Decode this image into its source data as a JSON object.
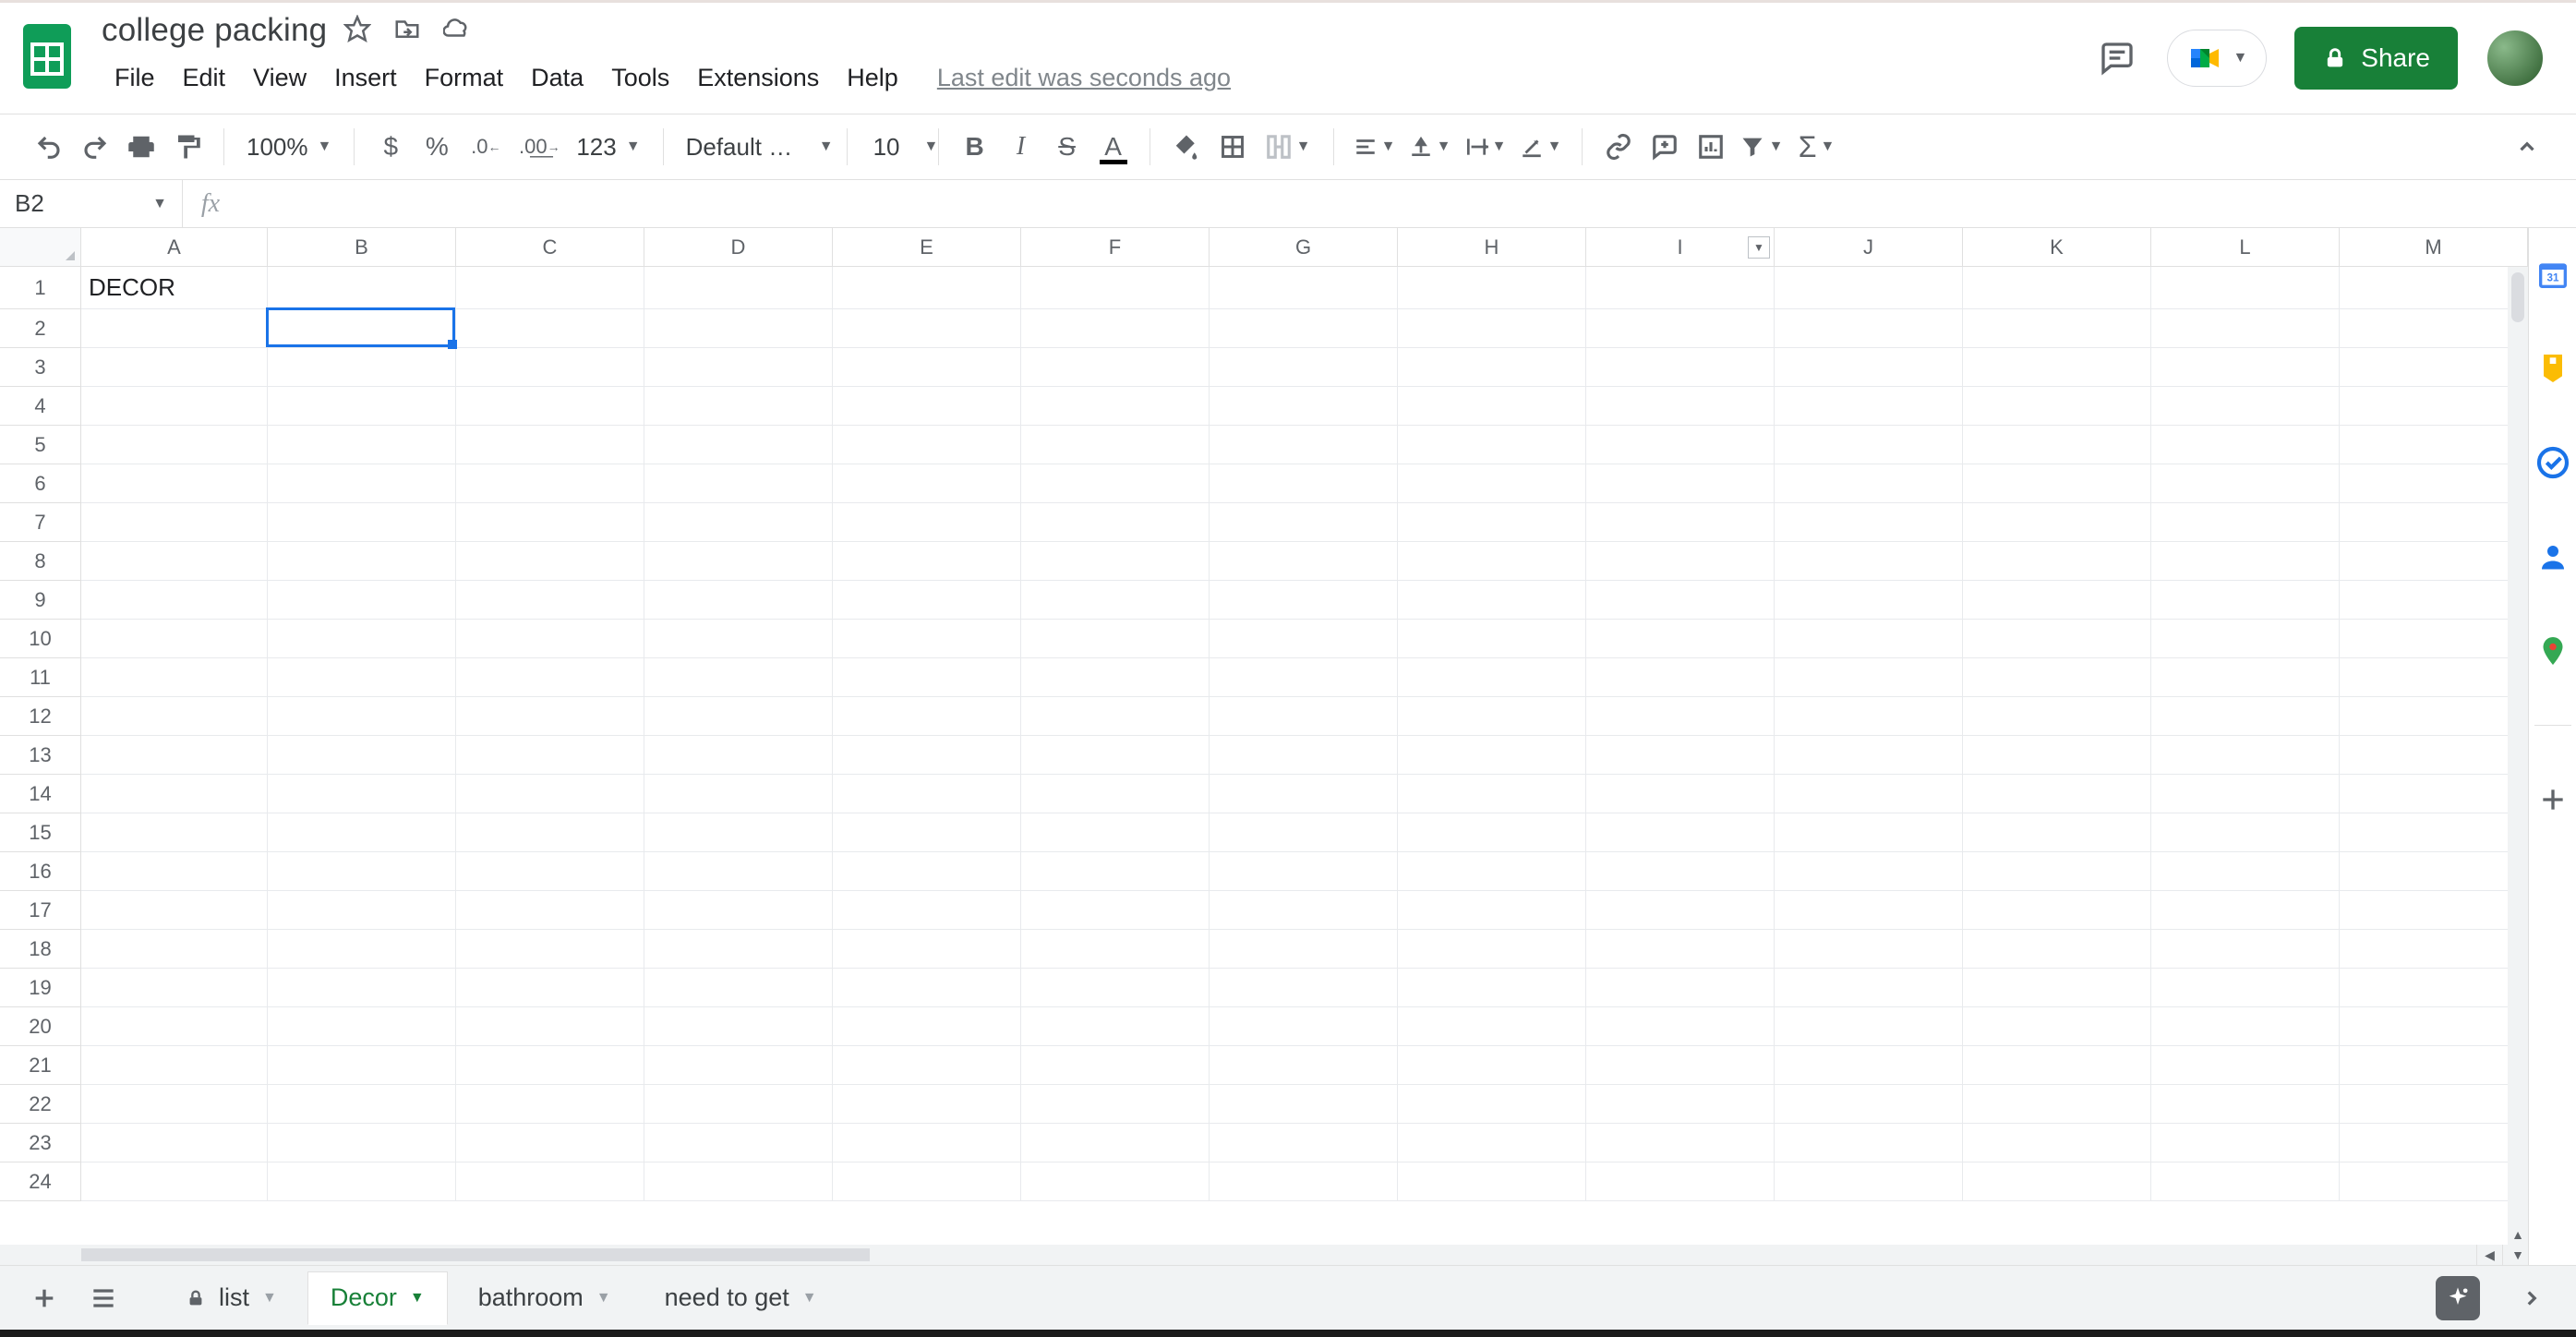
{
  "doc": {
    "title": "college packing",
    "last_edit": "Last edit was seconds ago"
  },
  "menus": {
    "file": "File",
    "edit": "Edit",
    "view": "View",
    "insert": "Insert",
    "format": "Format",
    "data": "Data",
    "tools": "Tools",
    "extensions": "Extensions",
    "help": "Help"
  },
  "share": {
    "label": "Share"
  },
  "toolbar": {
    "zoom": "100%",
    "currency": "$",
    "percent": "%",
    "dec_dec": ".0",
    "inc_dec": ".00",
    "more_fmt": "123",
    "font": "Default (Ari...",
    "font_size": "10"
  },
  "namebox": {
    "cell": "B2",
    "formula": ""
  },
  "columns": [
    "A",
    "B",
    "C",
    "D",
    "E",
    "F",
    "G",
    "H",
    "I",
    "J",
    "K",
    "L",
    "M"
  ],
  "rows": [
    "1",
    "2",
    "3",
    "4",
    "5",
    "6",
    "7",
    "8",
    "9",
    "10",
    "11",
    "12",
    "13",
    "14",
    "15",
    "16",
    "17",
    "18",
    "19",
    "20",
    "21",
    "22",
    "23",
    "24"
  ],
  "cells": {
    "A1": "DECOR"
  },
  "sheets": {
    "list": "list",
    "decor": "Decor",
    "bathroom": "bathroom",
    "need": "need to get"
  },
  "colors": {
    "accent_green": "#188038",
    "selection_blue": "#1a73e8"
  }
}
